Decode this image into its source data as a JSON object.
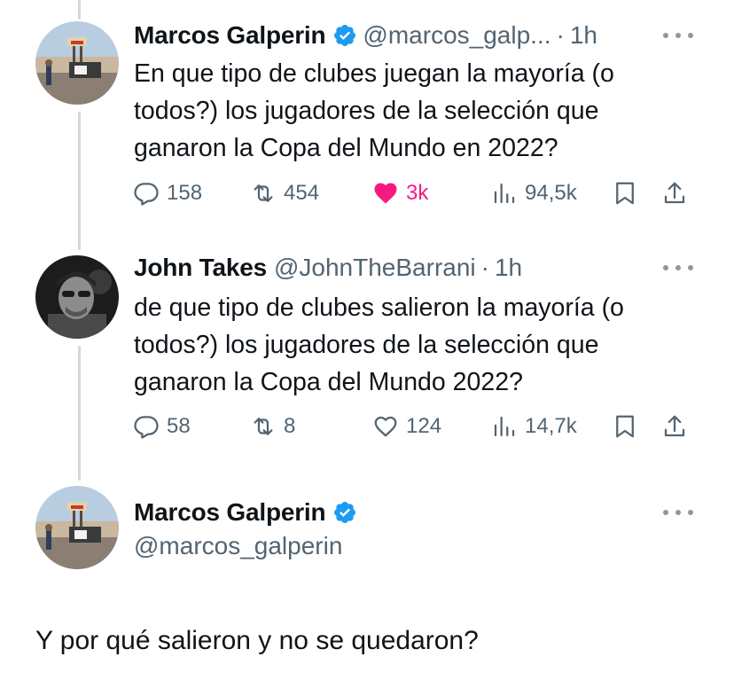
{
  "tweets": [
    {
      "name": "Marcos Galperin",
      "verified": true,
      "handle": "@marcos_galp...",
      "time": "1h",
      "text": "En que tipo de clubes juegan la mayoría (o\ntodos?) los jugadores de la selección que\nganaron la Copa del Mundo en 2022?",
      "replies": "158",
      "retweets": "454",
      "likes": "3k",
      "liked": true,
      "views": "94,5k"
    },
    {
      "name": "John Takes",
      "verified": false,
      "handle": "@JohnTheBarrani",
      "time": "1h",
      "text": "de que tipo de clubes salieron la mayoría (o\ntodos?) los jugadores de la selección que\nganaron la Copa del Mundo 2022?",
      "replies": "58",
      "retweets": "8",
      "likes": "124",
      "liked": false,
      "views": "14,7k"
    }
  ],
  "detail": {
    "name": "Marcos Galperin",
    "verified": true,
    "handle": "@marcos_galperin",
    "text": "Y por qué salieron y no se quedaron?"
  },
  "colors": {
    "verified": "#1d9bf0",
    "like": "#f91880",
    "secondary_text": "#536471",
    "thread_line": "#cfd9de"
  },
  "icons": [
    "reply-icon",
    "retweet-icon",
    "like-icon",
    "views-icon",
    "bookmark-icon",
    "share-icon",
    "verified-icon",
    "more-icon"
  ]
}
